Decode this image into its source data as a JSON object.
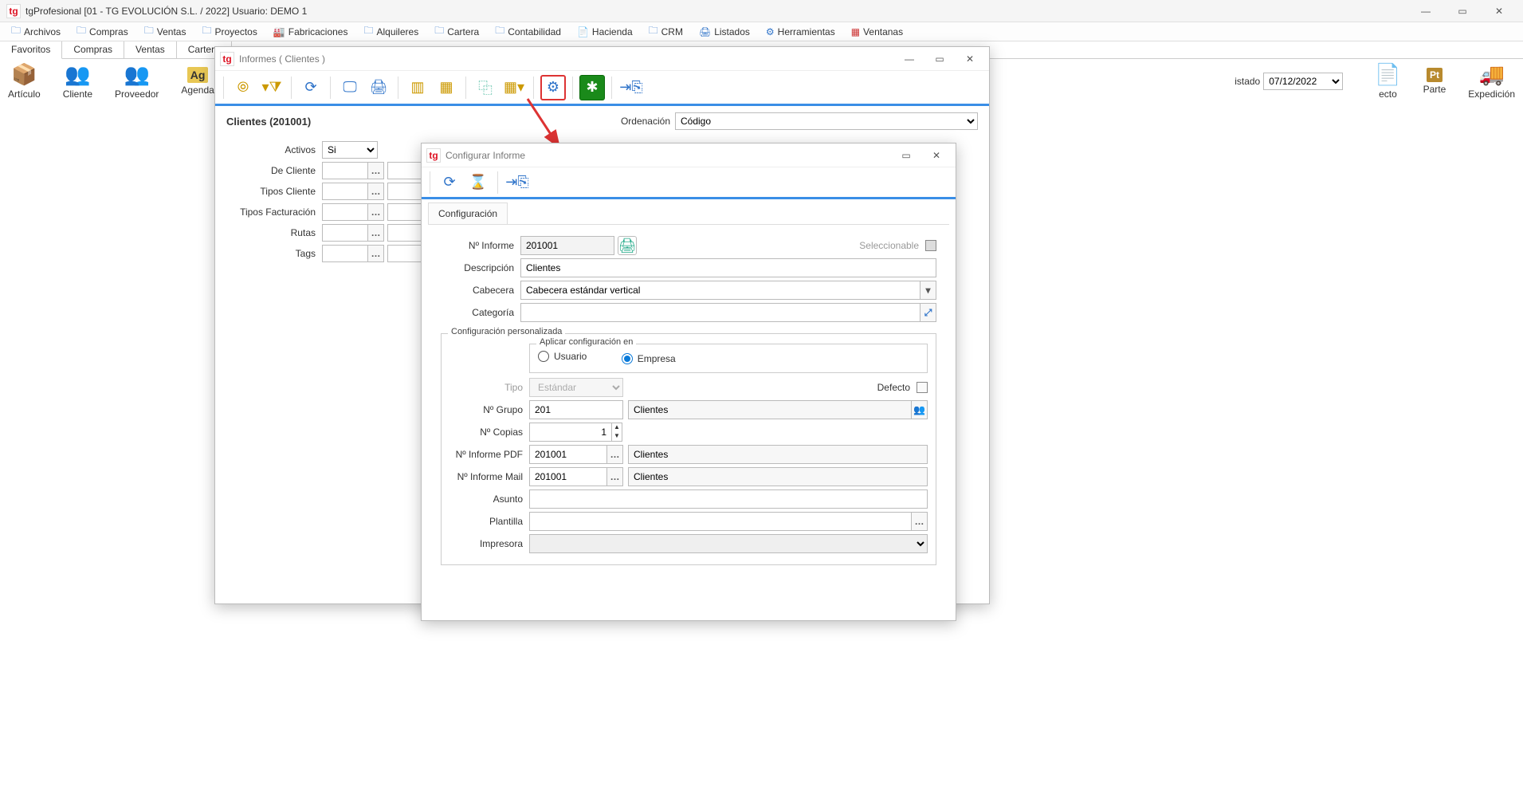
{
  "app_title": "tgProfesional [01 - TG EVOLUCIÓN S.L. / 2022] Usuario: DEMO 1",
  "menu": [
    "Archivos",
    "Compras",
    "Ventas",
    "Proyectos",
    "Fabricaciones",
    "Alquileres",
    "Cartera",
    "Contabilidad",
    "Hacienda",
    "CRM",
    "Listados",
    "Herramientas",
    "Ventanas"
  ],
  "tabs": [
    "Favoritos",
    "Compras",
    "Ventas",
    "Cartera"
  ],
  "ribbon": {
    "items": [
      {
        "label": "Artículo"
      },
      {
        "label": "Cliente"
      },
      {
        "label": "Proveedor"
      },
      {
        "label": "Agenda"
      }
    ],
    "right": [
      {
        "label_suffix": "ecto"
      },
      {
        "label": "Parte"
      },
      {
        "label": "Expedición"
      }
    ],
    "istado_label": "istado",
    "istado_value": "07/12/2022"
  },
  "win2": {
    "title": "Informes (  Clientes )",
    "header": "Clientes (201001)",
    "ordenacion_label": "Ordenación",
    "ordenacion_value": "Código",
    "filters": {
      "activos_label": "Activos",
      "activos_value": "Si",
      "decliente_label": "De Cliente",
      "tiposcliente_label": "Tipos Cliente",
      "tiposfact_label": "Tipos Facturación",
      "rutas_label": "Rutas",
      "tags_label": "Tags"
    }
  },
  "dlg": {
    "title": "Configurar Informe",
    "tab": "Configuración",
    "ninforme_label": "Nº Informe",
    "ninforme_value": "201001",
    "seleccionable": "Seleccionable",
    "descripcion_label": "Descripción",
    "descripcion_value": "Clientes",
    "cabecera_label": "Cabecera",
    "cabecera_value": "Cabecera estándar vertical",
    "categoria_label": "Categoría",
    "categoria_value": "",
    "grp_title": "Configuración personalizada",
    "apply_legend": "Aplicar configuración en",
    "radio_usuario": "Usuario",
    "radio_empresa": "Empresa",
    "tipo_label": "Tipo",
    "tipo_value": "Estándar",
    "defecto": "Defecto",
    "ngrupo_label": "Nº Grupo",
    "ngrupo_value": "201",
    "ngrupo_desc": "Clientes",
    "ncopias_label": "Nº Copias",
    "ncopias_value": "1",
    "npdf_label": "Nº Informe PDF",
    "npdf_value": "201001",
    "npdf_desc": "Clientes",
    "nmail_label": "Nº Informe Mail",
    "nmail_value": "201001",
    "nmail_desc": "Clientes",
    "asunto_label": "Asunto",
    "plantilla_label": "Plantilla",
    "impresora_label": "Impresora"
  }
}
